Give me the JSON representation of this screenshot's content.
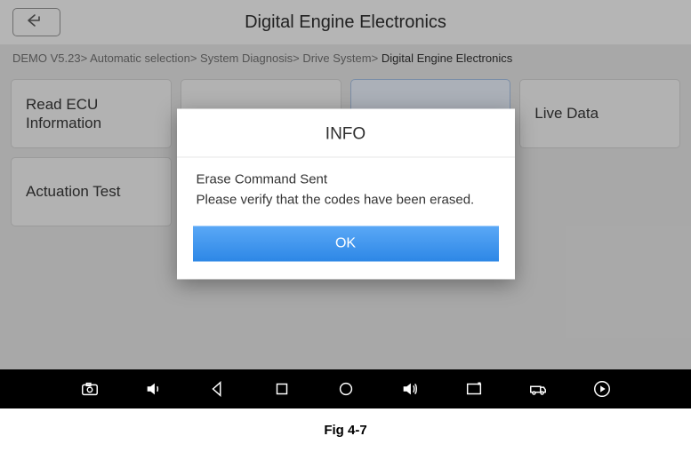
{
  "header": {
    "title": "Digital Engine Electronics"
  },
  "breadcrumb": {
    "items": [
      "DEMO V5.23",
      "Automatic selection",
      "System Diagnosis",
      "Drive System"
    ],
    "last": "Digital Engine Electronics",
    "separator": ">"
  },
  "tiles": [
    {
      "label": "Read ECU Information",
      "selected": false
    },
    {
      "label": "",
      "selected": false
    },
    {
      "label": "",
      "selected": true
    },
    {
      "label": "Live Data",
      "selected": false
    },
    {
      "label": "Actuation Test",
      "selected": false
    }
  ],
  "modal": {
    "title": "INFO",
    "line1": "Erase Command Sent",
    "line2": "Please verify that the codes have been erased.",
    "ok_label": "OK"
  },
  "caption": "Fig 4-7"
}
